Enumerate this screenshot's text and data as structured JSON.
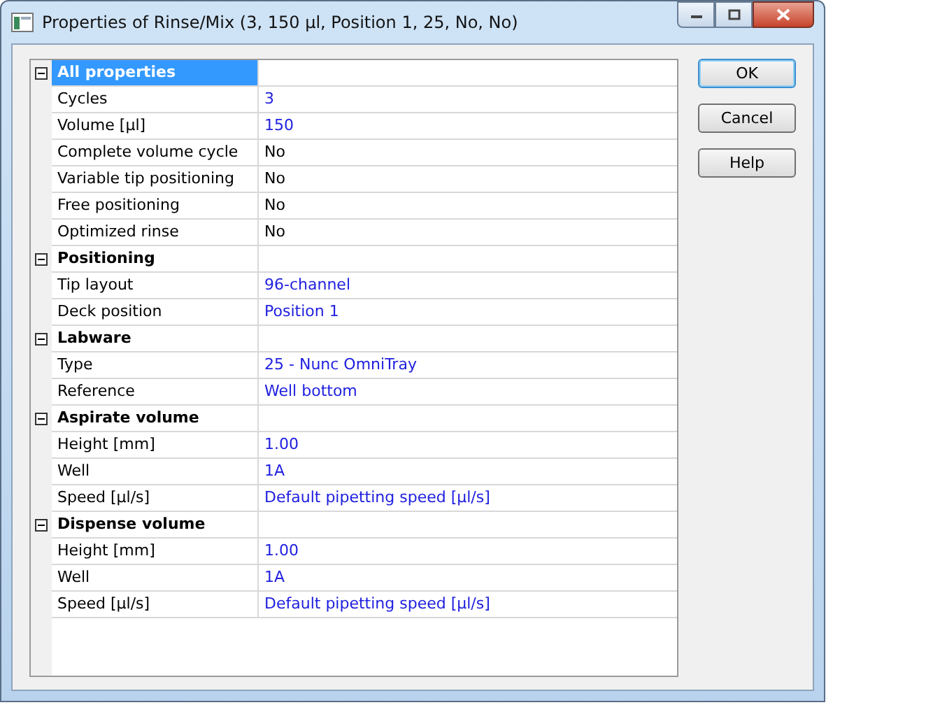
{
  "window": {
    "title": "Properties of Rinse/Mix (3, 150 µl, Position 1, 25, No, No)"
  },
  "groups": [
    {
      "title": "All properties",
      "expanded": true,
      "selected": true,
      "rows": [
        {
          "name": "Cycles",
          "value": "3",
          "changed": true
        },
        {
          "name": "Volume [µl]",
          "value": "150",
          "changed": true
        },
        {
          "name": "Complete volume cycle",
          "value": "No",
          "changed": false
        },
        {
          "name": "Variable tip positioning",
          "value": "No",
          "changed": false
        },
        {
          "name": "Free positioning",
          "value": "No",
          "changed": false
        },
        {
          "name": "Optimized rinse",
          "value": "No",
          "changed": false
        }
      ]
    },
    {
      "title": "Positioning",
      "expanded": true,
      "selected": false,
      "rows": [
        {
          "name": "Tip layout",
          "value": "96-channel",
          "changed": true
        },
        {
          "name": "Deck position",
          "value": "Position 1",
          "changed": true
        }
      ]
    },
    {
      "title": "Labware",
      "expanded": true,
      "selected": false,
      "rows": [
        {
          "name": "Type",
          "value": "25 - Nunc OmniTray",
          "changed": true
        },
        {
          "name": "Reference",
          "value": "Well bottom",
          "changed": true
        }
      ]
    },
    {
      "title": "Aspirate volume",
      "expanded": true,
      "selected": false,
      "rows": [
        {
          "name": "Height [mm]",
          "value": "1.00",
          "changed": true
        },
        {
          "name": "Well",
          "value": "1A",
          "changed": true
        },
        {
          "name": "Speed [µl/s]",
          "value": "Default pipetting speed [µl/s]",
          "changed": true
        }
      ]
    },
    {
      "title": "Dispense volume",
      "expanded": true,
      "selected": false,
      "rows": [
        {
          "name": "Height [mm]",
          "value": "1.00",
          "changed": true
        },
        {
          "name": "Well",
          "value": "1A",
          "changed": true
        },
        {
          "name": "Speed [µl/s]",
          "value": "Default pipetting speed [µl/s]",
          "changed": true
        }
      ]
    }
  ],
  "buttons": [
    {
      "label": "OK",
      "default": true
    },
    {
      "label": "Cancel",
      "default": false
    },
    {
      "label": "Help",
      "default": false
    }
  ]
}
